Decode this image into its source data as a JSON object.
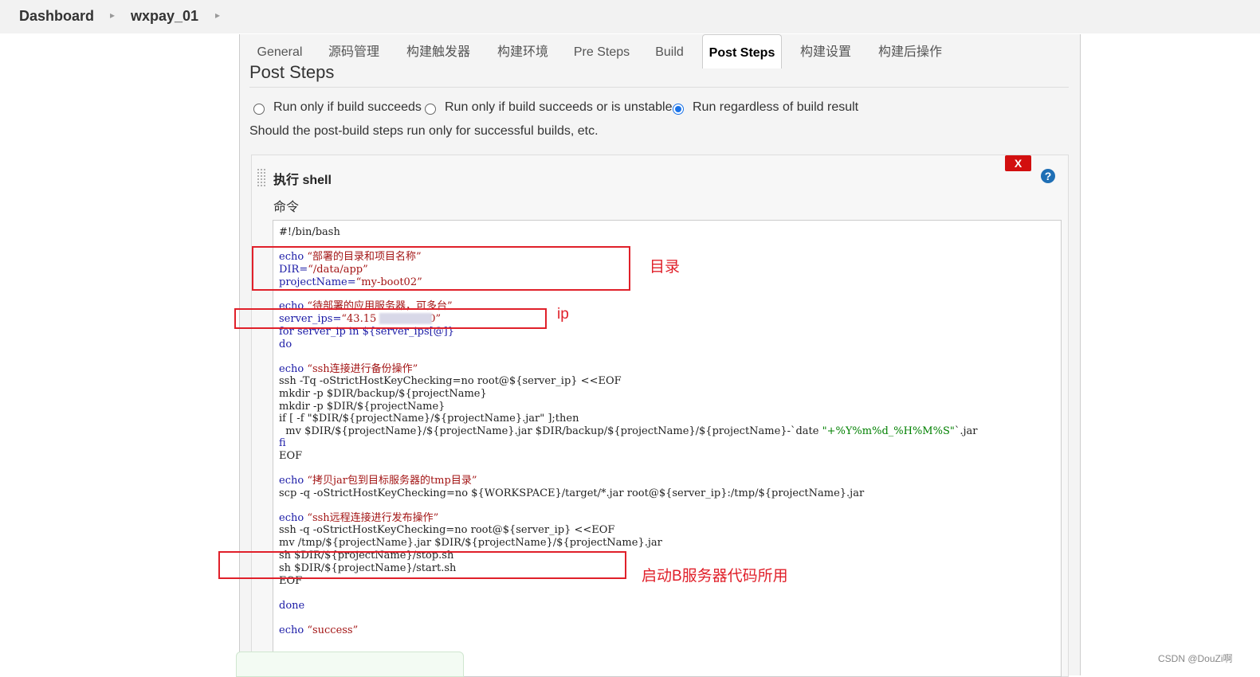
{
  "breadcrumb": {
    "dashboard": "Dashboard",
    "job": "wxpay_01"
  },
  "tabs": [
    "General",
    "源码管理",
    "构建触发器",
    "构建环境",
    "Pre Steps",
    "Build",
    "Post Steps",
    "构建设置",
    "构建后操作"
  ],
  "active_tab": "Post Steps",
  "section": {
    "title": "Post Steps",
    "radio_options": [
      "Run only if build succeeds",
      "Run only if build succeeds or is unstable",
      "Run regardless of build result"
    ],
    "selected_option": "Run regardless of build result",
    "description": "Should the post-build steps run only for successful builds, etc."
  },
  "step": {
    "title": "执行 shell",
    "delete_label": "X",
    "help_label": "?",
    "command_label": "命令",
    "code": {
      "l1": "#!/bin/bash",
      "l2a": "echo ",
      "l2b": "“部署的目录和项目名称”",
      "l3a": "DIR=",
      "l3b": "“/data/app”",
      "l4a": "projectName=",
      "l4b": "“my-boot02”",
      "l5a": "echo ",
      "l5b": "“待部署的应用服务器，可多台”",
      "l6a": "server_ips=",
      "l6b": "“43.15",
      "l6c": "0”",
      "l7": "for server_ip in ${server_ips[@]}",
      "l8": "do",
      "l9a": "echo ",
      "l9b": "“ssh连接进行备份操作”",
      "l10": "ssh -Tq -oStrictHostKeyChecking=no root@${server_ip} <<EOF",
      "l11": "mkdir -p $DIR/backup/${projectName}",
      "l12": "mkdir -p $DIR/${projectName}",
      "l13": "if [ -f \"$DIR/${projectName}/${projectName}.jar\" ];then",
      "l14a": "  mv $DIR/${projectName}/${projectName}.jar $DIR/backup/${projectName}/${projectName}-`date ",
      "l14b": "\"+%Y%m%d_%H%M%S\"",
      "l14c": "`.jar",
      "l15": "fi",
      "l16": "EOF",
      "l17a": "echo ",
      "l17b": "“拷贝jar包到目标服务器的tmp目录”",
      "l18": "scp -q -oStrictHostKeyChecking=no ${WORKSPACE}/target/*.jar root@${server_ip}:/tmp/${projectName}.jar",
      "l19a": "echo ",
      "l19b": "“ssh远程连接进行发布操作”",
      "l20": "ssh -q -oStrictHostKeyChecking=no root@${server_ip} <<EOF",
      "l21": "mv /tmp/${projectName}.jar $DIR/${projectName}/${projectName}.jar",
      "l22": "sh $DIR/${projectName}/stop.sh",
      "l23": "sh $DIR/${projectName}/start.sh",
      "l24": "EOF",
      "l25": "done",
      "l26a": "echo ",
      "l26b": "“success”"
    }
  },
  "annotations": {
    "dir": "目录",
    "ip": "ip",
    "start": "启动B服务器代码所用"
  },
  "watermark": "CSDN @DouZi啊",
  "colors": {
    "annotation": "#e0202a",
    "delete": "#d20f0f",
    "help": "#1f6fb5",
    "radio_selected": "#1a73e8"
  }
}
